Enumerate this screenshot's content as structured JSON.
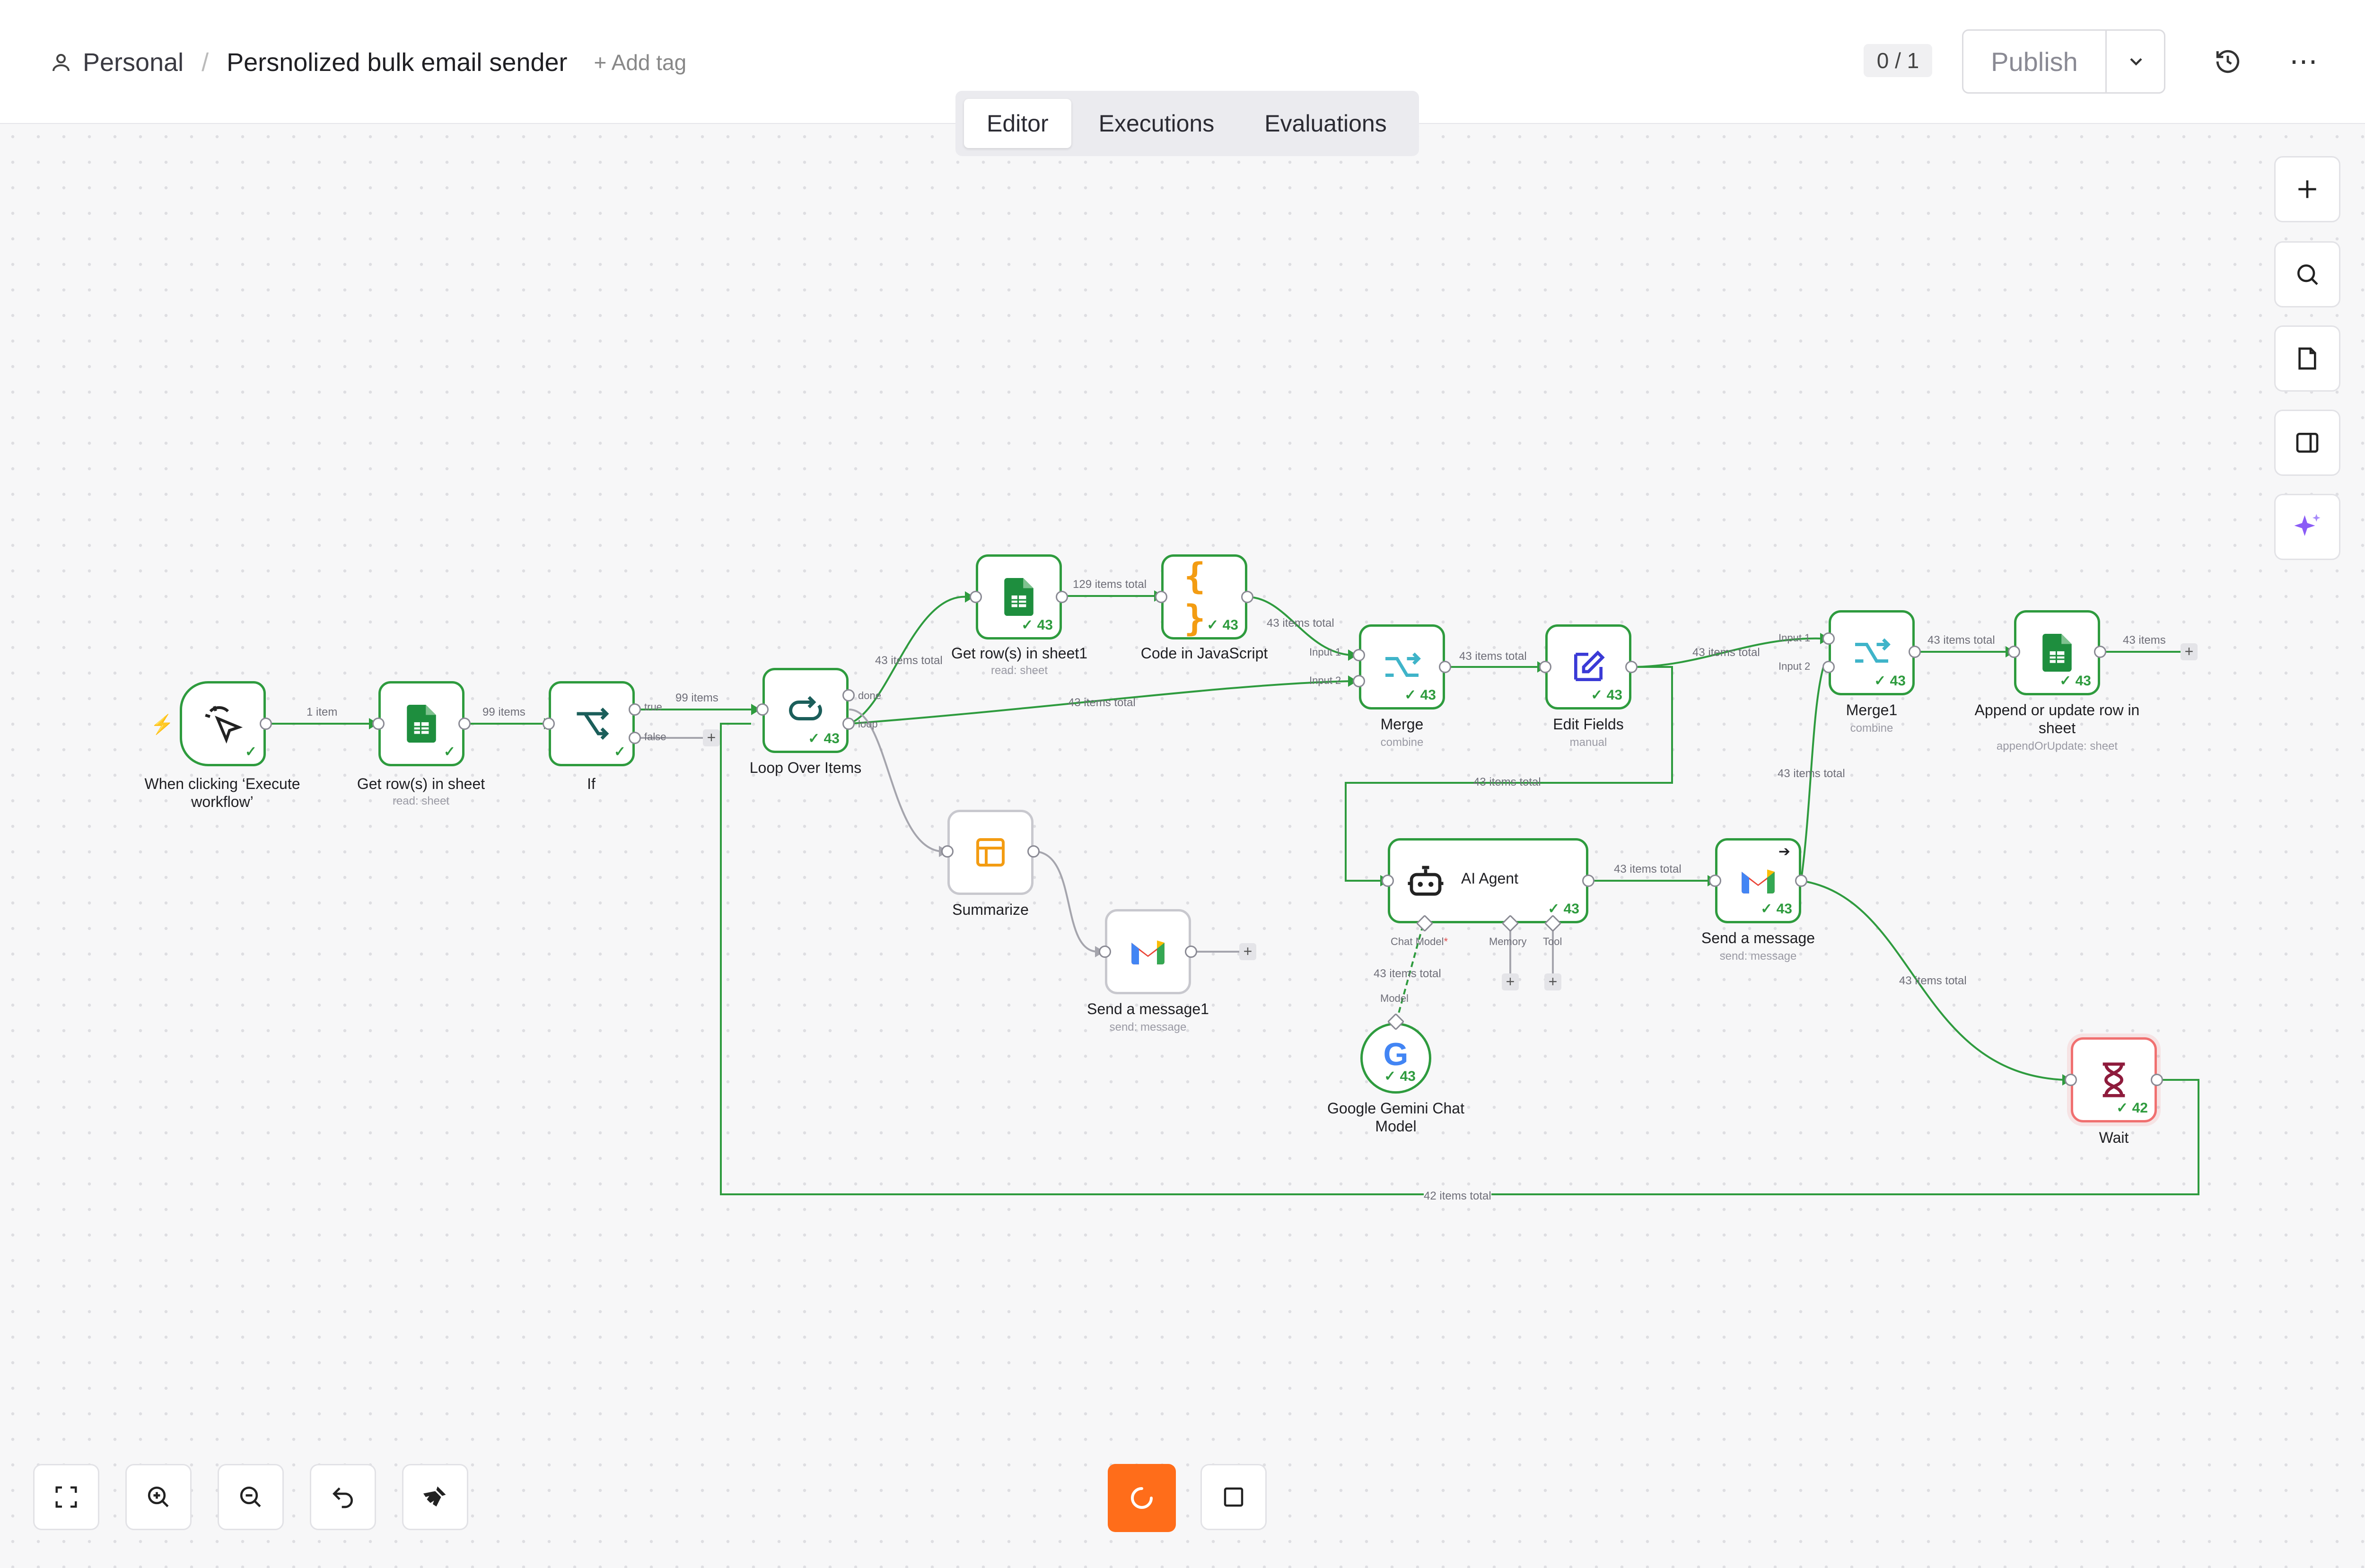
{
  "header": {
    "project": "Personal",
    "separator": "/",
    "workflow_name": "Persnolized bulk email sender",
    "add_tag": "+ Add tag",
    "version_count": "0 / 1",
    "publish_label": "Publish"
  },
  "tabs": [
    {
      "label": "Editor",
      "active": true
    },
    {
      "label": "Executions",
      "active": false
    },
    {
      "label": "Evaluations",
      "active": false
    }
  ],
  "nodes": {
    "trigger": {
      "label": "When clicking ‘Execute workflow’"
    },
    "get_rows": {
      "label": "Get row(s) in sheet",
      "sub": "read: sheet"
    },
    "if": {
      "label": "If",
      "true": "true",
      "false": "false"
    },
    "loop": {
      "label": "Loop Over Items",
      "count": "43",
      "done": "done",
      "loop": "loop"
    },
    "get_rows1": {
      "label": "Get row(s) in sheet1",
      "sub": "read: sheet",
      "count": "43"
    },
    "code": {
      "label": "Code in JavaScript",
      "count": "43"
    },
    "merge": {
      "label": "Merge",
      "sub": "combine",
      "count": "43",
      "in1": "Input 1",
      "in2": "Input 2"
    },
    "edit": {
      "label": "Edit Fields",
      "sub": "manual",
      "count": "43"
    },
    "merge1": {
      "label": "Merge1",
      "sub": "combine",
      "count": "43",
      "in1": "Input 1",
      "in2": "Input 2"
    },
    "append": {
      "label": "Append or update row in sheet",
      "sub": "appendOrUpdate: sheet",
      "count": "43"
    },
    "summarize": {
      "label": "Summarize"
    },
    "send1": {
      "label": "Send a message1",
      "sub": "send: message"
    },
    "agent": {
      "label": "AI Agent",
      "count": "43",
      "chat_model": "Chat Model",
      "memory": "Memory",
      "tool": "Tool"
    },
    "gemini": {
      "label": "Google Gemini Chat Model",
      "count": "43",
      "model": "Model"
    },
    "send": {
      "label": "Send a message",
      "sub": "send: message",
      "count": "43"
    },
    "wait": {
      "label": "Wait",
      "count": "42"
    }
  },
  "edges": {
    "e1": "1 item",
    "e2": "99 items",
    "e3": "99 items",
    "e4": "43 items total",
    "e5": "129 items total",
    "e6": "43 items total",
    "e7": "43 items total",
    "e8": "43 items total",
    "e9": "43 items total",
    "e10": "43 items total",
    "e11": "43 items total",
    "e12": "43 items",
    "e13": "43 items total",
    "e14": "43 items total",
    "e15": "43 items total",
    "e16": "43 items total",
    "e17": "42 items total"
  },
  "colors": {
    "accent": "#ff6d1a",
    "success": "#2e9b3e",
    "sheets": "#1e8e3e"
  }
}
